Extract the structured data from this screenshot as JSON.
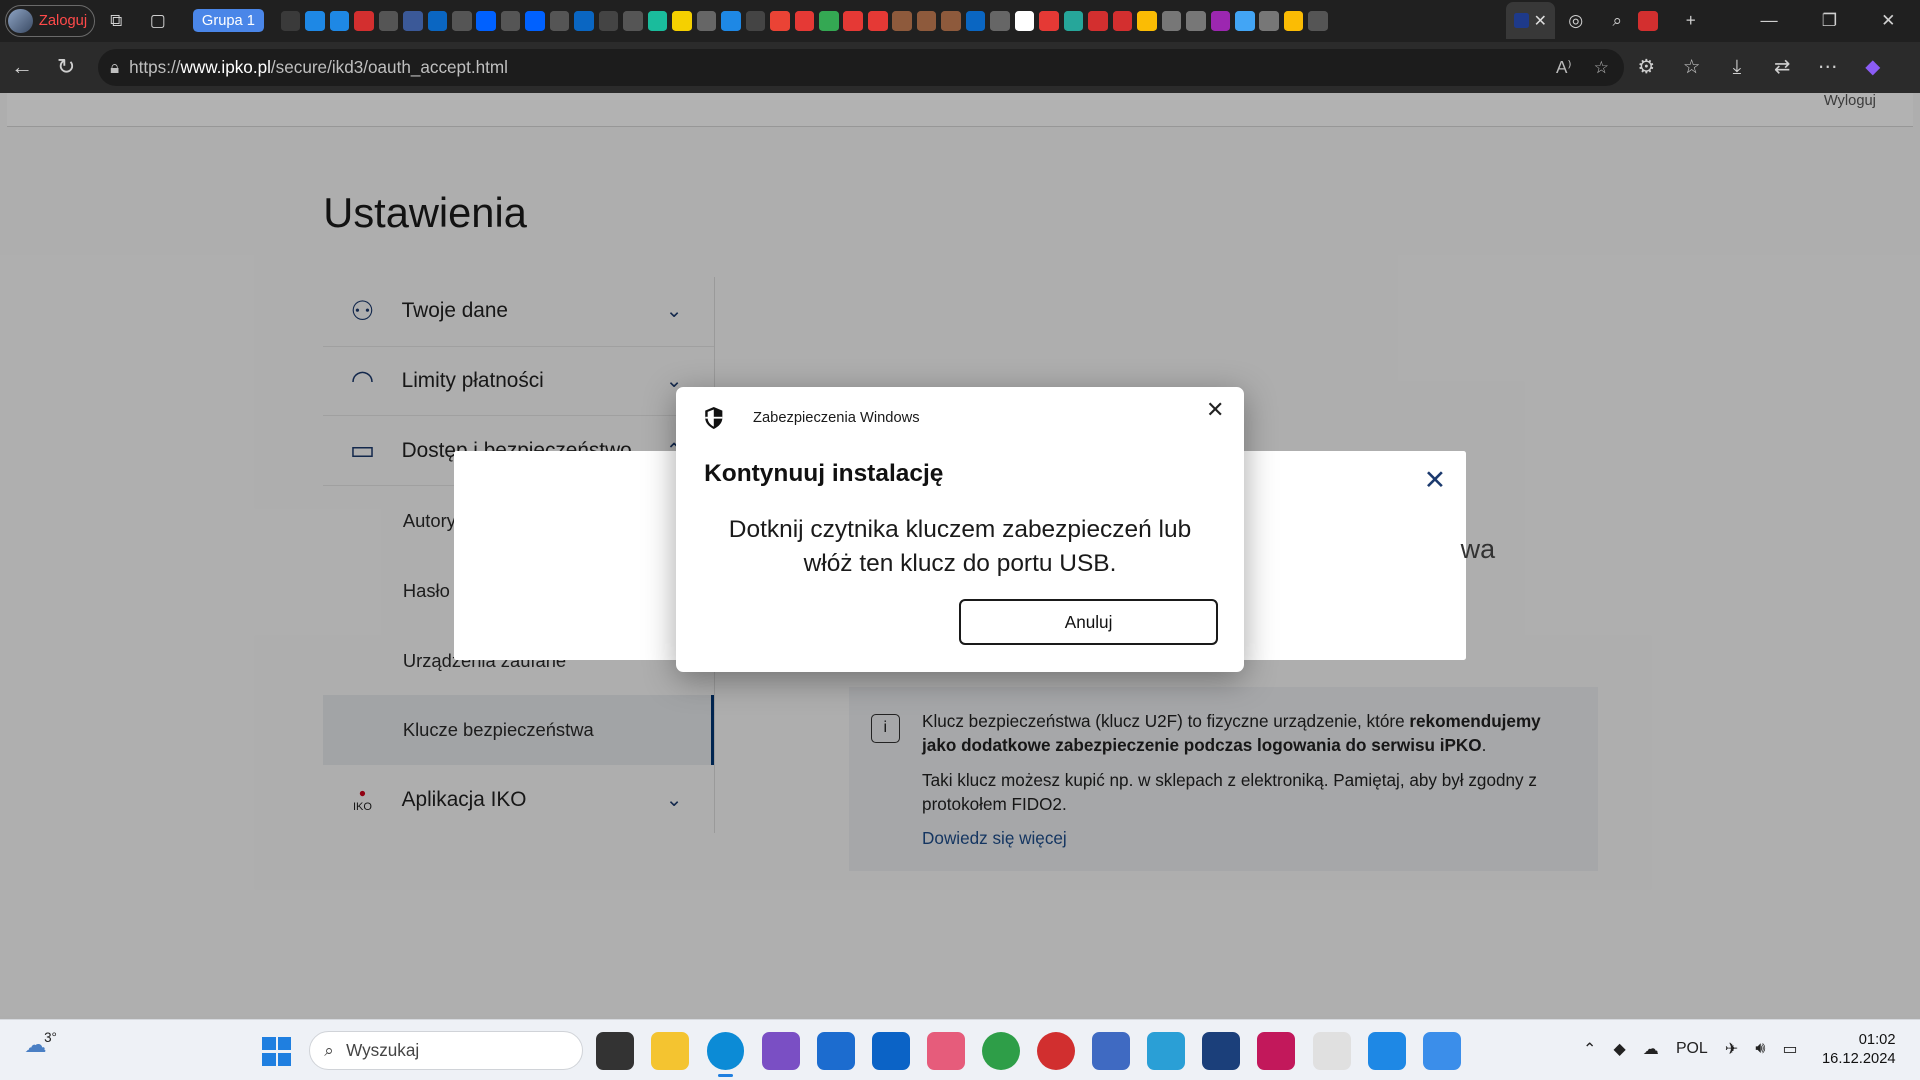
{
  "browser": {
    "profile_label": "Zaloguj",
    "tab_group": "Grupa 1",
    "url_prefix": "https://",
    "url_host": "www.ipko.pl",
    "url_path": "/secure/ikd3/oauth_accept.html"
  },
  "page": {
    "logout": "Wyloguj",
    "title": "Ustawienia",
    "menu": [
      {
        "label": "Twoje dane",
        "icon": "user-icon"
      },
      {
        "label": "Limity płatności",
        "icon": "gauge-icon"
      },
      {
        "label": "Dostęp i bezpieczeństwo",
        "icon": "laptop-lock-icon"
      }
    ],
    "submenu": [
      {
        "label": "Autoryzacja"
      },
      {
        "label": "Hasło"
      },
      {
        "label": "Urządzenia zaufane"
      },
      {
        "label": "Klucze bezpieczeństwa"
      }
    ],
    "menu_iko": {
      "label": "Aplikacja IKO",
      "badge": "IKO"
    },
    "info": {
      "icon": "i",
      "text1_a": "Klucz bezpieczeństwa (klucz U2F) to fizyczne urządzenie, które ",
      "text1_b": "rekomendujemy jako dodatkowe zabezpieczenie podczas logowania do serwisu iPKO",
      "text1_c": ".",
      "text2": "Taki klucz możesz kupić np. w sklepach z elektroniką. Pamiętaj, aby był zgodny z protokołem FIDO2.",
      "link": "Dowiedz się więcej"
    },
    "bank_modal_peek": "wa"
  },
  "dialog": {
    "header": "Zabezpieczenia Windows",
    "title": "Kontynuuj instalację",
    "message_line1": "Dotknij czytnika kluczem zabezpieczeń lub",
    "message_line2": "włóż ten klucz do portu USB.",
    "cancel": "Anuluj"
  },
  "taskbar": {
    "weather_temp": "3°",
    "search_placeholder": "Wyszukaj",
    "lang": "POL",
    "time": "01:02",
    "date": "16.12.2024"
  },
  "colors": {
    "brand_navy": "#003574",
    "accent_blue": "#1f7fe0"
  }
}
